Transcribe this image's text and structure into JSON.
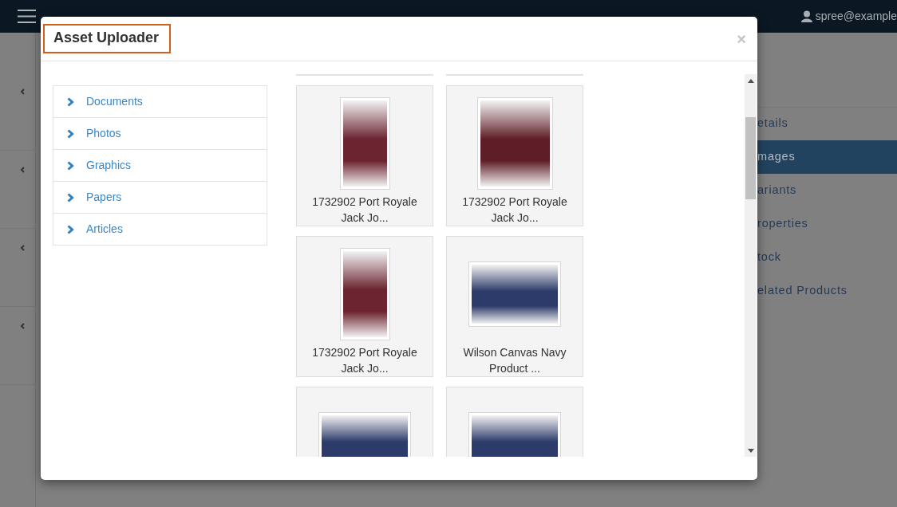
{
  "topbar": {
    "user": "spree@example"
  },
  "side_menu": [
    {
      "label": "etails",
      "selected": false
    },
    {
      "label": "mages",
      "selected": true
    },
    {
      "label": "ariants",
      "selected": false
    },
    {
      "label": "roperties",
      "selected": false
    },
    {
      "label": "tock",
      "selected": false
    },
    {
      "label": "elated Products",
      "selected": false
    }
  ],
  "modal": {
    "title": "Asset Uploader",
    "close": "×",
    "folders": [
      {
        "label": "Documents"
      },
      {
        "label": "Photos"
      },
      {
        "label": "Graphics"
      },
      {
        "label": "Papers"
      },
      {
        "label": "Articles"
      }
    ],
    "assets": [
      {
        "kind": "tall",
        "caption": "1732902 Port Royale Jack Jo..."
      },
      {
        "kind": "closeup",
        "caption": "1732902 Port Royale Jack Jo..."
      },
      {
        "kind": "tall",
        "caption": "1732902 Port Royale Jack Jo..."
      },
      {
        "kind": "wide",
        "caption": "Wilson Canvas Navy Product ..."
      },
      {
        "kind": "wide"
      },
      {
        "kind": "wide"
      }
    ]
  }
}
